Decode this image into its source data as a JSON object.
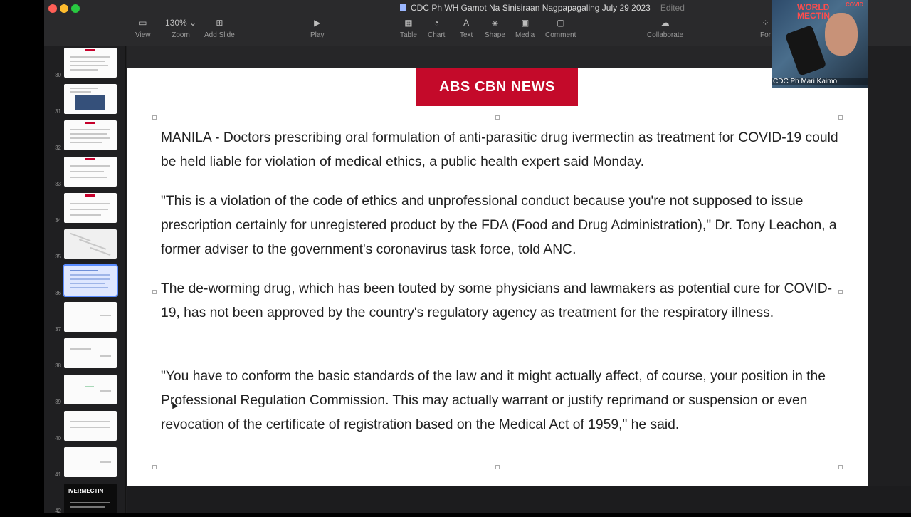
{
  "window": {
    "title": "CDC Ph WH Gamot Na Sinisiraan Nagpapagaling July 29 2023",
    "status": "Edited"
  },
  "toolbar": {
    "view": "View",
    "zoom_value": "130%",
    "zoom": "Zoom",
    "add_slide": "Add Slide",
    "play": "Play",
    "table": "Table",
    "chart": "Chart",
    "text": "Text",
    "shape": "Shape",
    "media": "Media",
    "comment": "Comment",
    "collaborate": "Collaborate",
    "format_partial": "For"
  },
  "sidebar": {
    "slides": [
      {
        "num": "30"
      },
      {
        "num": "31"
      },
      {
        "num": "32"
      },
      {
        "num": "33"
      },
      {
        "num": "34"
      },
      {
        "num": "35"
      },
      {
        "num": "36"
      },
      {
        "num": "37"
      },
      {
        "num": "38"
      },
      {
        "num": "39"
      },
      {
        "num": "40"
      },
      {
        "num": "41"
      },
      {
        "num": "42"
      }
    ],
    "thumb_ivermectin": "IVERMECTIN"
  },
  "slide": {
    "logo": "ABS CBN NEWS",
    "paragraphs": [
      "MANILA - Doctors prescribing oral formulation of anti-parasitic drug ivermectin as treatment for COVID-19 could be held liable for violation of medical ethics, a public health expert said Monday.",
      "\"This is a violation of the code of ethics and unprofessional conduct because you're not supposed to issue prescription certainly for unregistered product by the FDA (Food and Drug Administration),\" Dr. Tony Leachon, a former adviser to the government's coronavirus task force, told ANC.",
      "The de-worming drug, which has been touted by some physicians and lawmakers as potential cure for COVID-19, has not been approved by the country's regulatory agency as treatment for the respiratory illness.",
      "\"You have to conform the basic standards of the law and it might actually affect, of course, your position in the Professional Regulation Commission. This may actually warrant or justify reprimand or suspension or even revocation of the certificate of registration based on the Medical Act of 1959,\" he said."
    ]
  },
  "webcam": {
    "name": "CDC Ph Mari Kaimo",
    "sign": "WORLD\nMECTIN",
    "covid": "COVID"
  },
  "colors": {
    "accent": "#5a8cff",
    "brand_red": "#c40a2a"
  }
}
